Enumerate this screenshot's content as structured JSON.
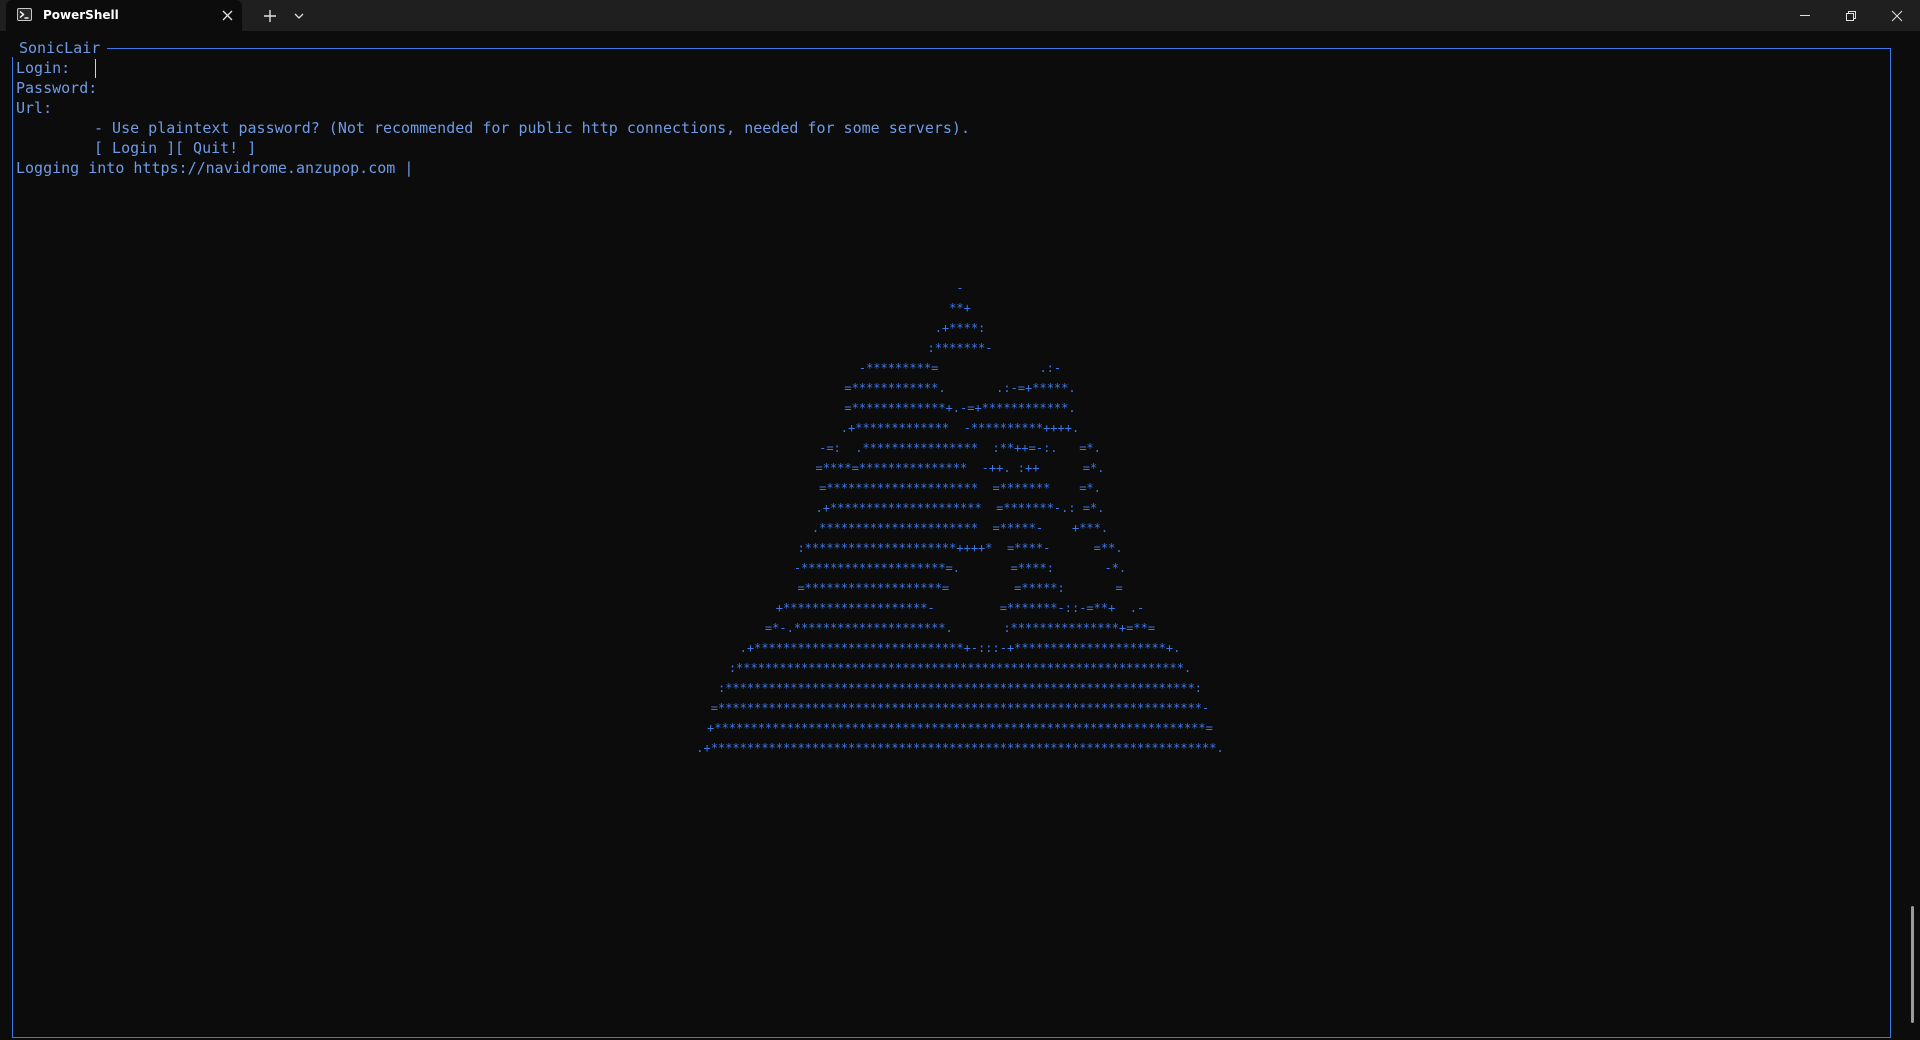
{
  "window": {
    "tab_title": "PowerShell",
    "tab_icon": "powershell-icon",
    "close_tab_icon": "close-icon",
    "new_tab_icon": "plus-icon",
    "dropdown_icon": "chevron-down-icon",
    "minimize_icon": "minimize-icon",
    "maximize_icon": "restore-icon",
    "close_window_icon": "close-icon"
  },
  "app": {
    "frame_title": "SonicLair",
    "login_label": "Login:",
    "login_value": "",
    "password_label": "Password:",
    "password_value": "",
    "url_label": "Url:",
    "url_value": "",
    "plaintext_option": "- Use plaintext password? (Not recommended for public http connections, needed for some servers).",
    "login_button": "[ Login ]",
    "quit_button": "[ Quit! ]",
    "status": "Logging into https://navidrome.anzupop.com |",
    "ascii_art": [
      "-",
      "**+",
      ".+****:",
      ":*******-",
      "-*********=              .:-",
      "=************.       .:-=+*****.",
      "=*************+.-=+************.",
      ".+*************  -**********++++.",
      "-=:  .****************  :**++=-:.   =*.",
      "=****=***************  -++. :++      =*.",
      "=*********************  =*******    =*.",
      ".+*********************  =*******-.: =*.",
      ".**********************  =*****-    +***.",
      ":*********************++++*  =****-      =**.",
      "-********************=.       =****:       -*.",
      "=*******************=         =*****:       =",
      "+********************-         =*******-::-=**+  .-",
      "=*-.*********************.       :***************+=**=",
      ".+*****************************+-:::-+*********************+.",
      ":**************************************************************.",
      ":*****************************************************************:",
      "=*******************************************************************-",
      "+********************************************************************=",
      ".+**********************************************************************."
    ]
  },
  "colors": {
    "accent": "#3b78e7",
    "text": "#6f9be6",
    "background": "#0c0c0c",
    "titlebar": "#1f1f1f"
  }
}
